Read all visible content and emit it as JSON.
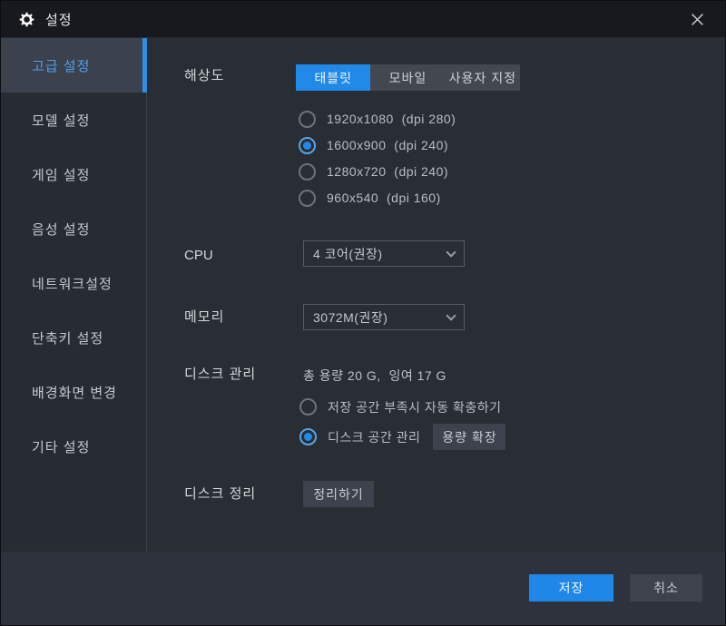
{
  "window": {
    "title": "설정"
  },
  "sidebar": {
    "items": [
      {
        "label": "고급 설정",
        "active": true
      },
      {
        "label": "모델 설정",
        "active": false
      },
      {
        "label": "게임 설정",
        "active": false
      },
      {
        "label": "음성 설정",
        "active": false
      },
      {
        "label": "네트워크설정",
        "active": false
      },
      {
        "label": "단축키 설정",
        "active": false
      },
      {
        "label": "배경화면 변경",
        "active": false
      },
      {
        "label": "기타 설정",
        "active": false
      }
    ]
  },
  "resolution": {
    "label": "해상도",
    "tabs": [
      {
        "label": "태블릿",
        "active": true
      },
      {
        "label": "모바일",
        "active": false
      },
      {
        "label": "사용자 지정",
        "active": false
      }
    ],
    "options": [
      {
        "label": "1920x1080  (dpi 280)",
        "selected": false
      },
      {
        "label": "1600x900  (dpi 240)",
        "selected": true
      },
      {
        "label": "1280x720  (dpi 240)",
        "selected": false
      },
      {
        "label": "960x540  (dpi 160)",
        "selected": false
      }
    ]
  },
  "cpu": {
    "label": "CPU",
    "value": "4 코어(권장)"
  },
  "memory": {
    "label": "메모리",
    "value": "3072M(권장)"
  },
  "disk": {
    "label": "디스크 관리",
    "summary": "총 용량 20 G,  잉여 17 G",
    "options": [
      {
        "label": "저장 공간 부족시 자동 확충하기",
        "selected": false
      },
      {
        "label": "디스크 공간 관리",
        "selected": true
      }
    ],
    "expand_button": "용량 확장"
  },
  "cleanup": {
    "label": "디스크 정리",
    "button": "정리하기"
  },
  "footer": {
    "save": "저장",
    "cancel": "취소"
  },
  "colors": {
    "accent": "#2189e8",
    "titlebar": "#17191e",
    "panel": "#292d34",
    "footer": "#2e323d",
    "selected_item_bg": "#3c414e",
    "selected_text": "#4fa0e8"
  }
}
